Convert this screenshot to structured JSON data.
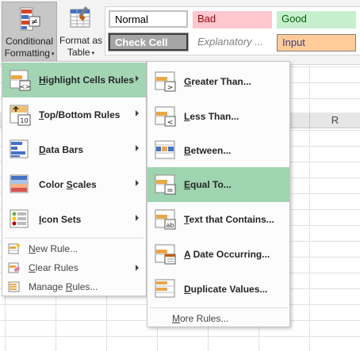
{
  "ribbon": {
    "conditional_formatting": {
      "line1": "Conditional",
      "line2": "Formatting",
      "caret": "▾"
    },
    "format_as_table": {
      "line1": "Format as",
      "line2": "Table",
      "caret": "▾"
    },
    "styles": {
      "normal": "Normal",
      "bad": "Bad",
      "good": "Good",
      "check_cell": "Check Cell",
      "explanatory": "Explanatory ...",
      "input": "Input"
    },
    "colors": {
      "bad_bg": "#ffc7ce",
      "bad_fg": "#9c0006",
      "good_bg": "#c6efce",
      "good_fg": "#006100",
      "input_bg": "#ffcc99",
      "input_fg": "#3f3f76",
      "check_bg": "#a5a5a5"
    }
  },
  "sheet": {
    "column_header": "R"
  },
  "main_menu": {
    "items": [
      {
        "accel": "H",
        "rest": "ighlight Cells Rules",
        "has_submenu": true,
        "highlighted": true,
        "icon": "highlight-cells-icon"
      },
      {
        "accel": "T",
        "rest": "op/Bottom Rules",
        "has_submenu": true,
        "highlighted": false,
        "icon": "top-bottom-icon",
        "icon_text": "10"
      },
      {
        "accel": "D",
        "rest": "ata Bars",
        "has_submenu": true,
        "highlighted": false,
        "icon": "data-bars-icon"
      },
      {
        "accel": "S",
        "pre": "Color ",
        "rest": "cales",
        "has_submenu": true,
        "highlighted": false,
        "icon": "color-scales-icon"
      },
      {
        "accel": "I",
        "rest": "con Sets",
        "has_submenu": true,
        "highlighted": false,
        "icon": "icon-sets-icon"
      }
    ],
    "small_items": [
      {
        "accel": "N",
        "rest": "ew Rule...",
        "has_submenu": false,
        "icon": "new-rule-icon"
      },
      {
        "accel": "C",
        "rest": "lear Rules",
        "has_submenu": true,
        "icon": "clear-rules-icon"
      },
      {
        "accel": "R",
        "pre": "Manage ",
        "rest": "ules...",
        "has_submenu": false,
        "icon": "manage-rules-icon"
      }
    ]
  },
  "sub_menu": {
    "items": [
      {
        "accel": "G",
        "rest": "reater Than...",
        "icon": "greater-than-icon",
        "symbol": ">"
      },
      {
        "accel": "L",
        "rest": "ess Than...",
        "icon": "less-than-icon",
        "symbol": "<"
      },
      {
        "accel": "B",
        "rest": "etween...",
        "icon": "between-icon"
      },
      {
        "accel": "E",
        "rest": "qual To...",
        "icon": "equal-to-icon",
        "symbol": "=",
        "highlighted": true
      },
      {
        "accel": "T",
        "rest": "ext that Contains...",
        "icon": "text-contains-icon",
        "symbol": "ab"
      },
      {
        "accel": "A",
        "rest": " Date Occurring...",
        "icon": "date-occurring-icon"
      },
      {
        "accel": "D",
        "rest": "uplicate Values...",
        "icon": "duplicate-values-icon"
      }
    ],
    "more_rules": {
      "pre": "",
      "accel": "M",
      "rest": "ore Rules..."
    }
  }
}
